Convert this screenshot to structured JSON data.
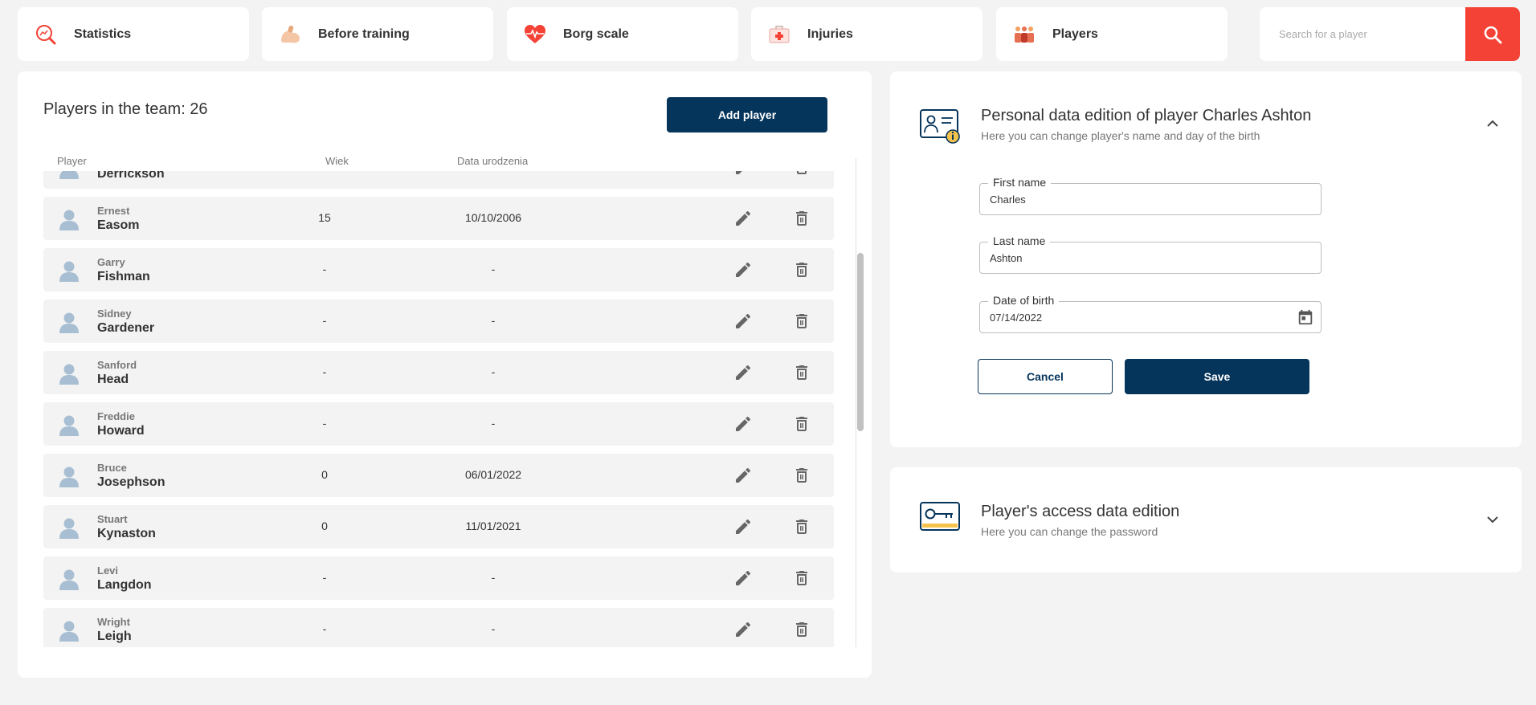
{
  "nav": {
    "items": [
      {
        "label": "Statistics",
        "icon": "statistics-magnifier-icon"
      },
      {
        "label": "Before training",
        "icon": "flexed-arm-icon"
      },
      {
        "label": "Borg scale",
        "icon": "heart-pulse-icon"
      },
      {
        "label": "Injuries",
        "icon": "first-aid-kit-icon"
      },
      {
        "label": "Players",
        "icon": "players-group-icon"
      }
    ],
    "search_placeholder": "Search for a player",
    "search_button_icon": "search-icon"
  },
  "colors": {
    "primary": "#06355c",
    "accent_red": "#f44336",
    "background": "#f3f3f3",
    "row_background": "#f3f3f3",
    "avatar": "#a8bfd3"
  },
  "players_panel": {
    "title": "Players in the team: 26",
    "add_button": "Add player",
    "columns": {
      "player": "Player",
      "age": "Wiek",
      "dob": "Data urodzenia"
    },
    "rows": [
      {
        "first": "",
        "last": "Derrickson",
        "age": "",
        "dob": ""
      },
      {
        "first": "Ernest",
        "last": "Easom",
        "age": "15",
        "dob": "10/10/2006"
      },
      {
        "first": "Garry",
        "last": "Fishman",
        "age": "-",
        "dob": "-"
      },
      {
        "first": "Sidney",
        "last": "Gardener",
        "age": "-",
        "dob": "-"
      },
      {
        "first": "Sanford",
        "last": "Head",
        "age": "-",
        "dob": "-"
      },
      {
        "first": "Freddie",
        "last": "Howard",
        "age": "-",
        "dob": "-"
      },
      {
        "first": "Bruce",
        "last": "Josephson",
        "age": "0",
        "dob": "06/01/2022"
      },
      {
        "first": "Stuart",
        "last": "Kynaston",
        "age": "0",
        "dob": "11/01/2021"
      },
      {
        "first": "Levi",
        "last": "Langdon",
        "age": "-",
        "dob": "-"
      },
      {
        "first": "Wright",
        "last": "Leigh",
        "age": "-",
        "dob": "-"
      }
    ]
  },
  "personal_panel": {
    "title": "Personal data edition of player Charles Ashton",
    "subtitle": "Here you can change player's name and day of the birth",
    "icon": "id-card-info-icon",
    "expanded": true,
    "first_name_label": "First name",
    "first_name_value": "Charles",
    "last_name_label": "Last name",
    "last_name_value": "Ashton",
    "dob_label": "Date of birth",
    "dob_value": "07/14/2022",
    "cancel": "Cancel",
    "save": "Save"
  },
  "access_panel": {
    "title": "Player's access data edition",
    "subtitle": "Here you can change the password",
    "icon": "key-card-icon",
    "expanded": false
  }
}
